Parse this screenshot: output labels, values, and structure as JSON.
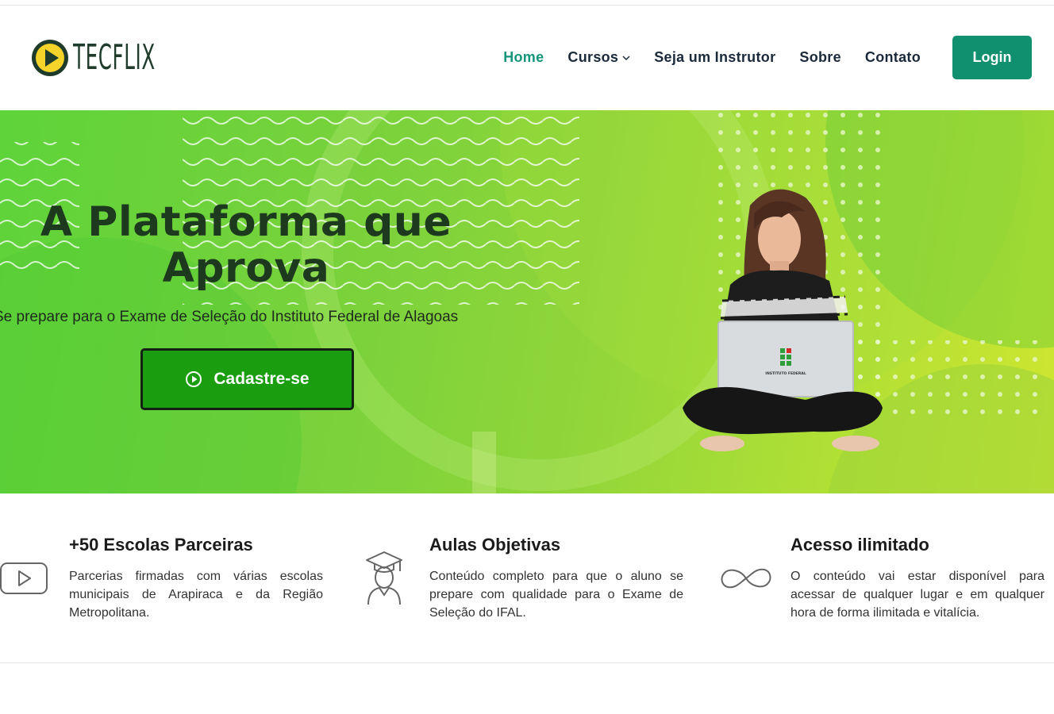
{
  "brand": {
    "name": "TECFLIX",
    "accent": "#11906f",
    "logo_yellow": "#f4d32a",
    "logo_dark": "#1f3b2b"
  },
  "nav": {
    "items": [
      {
        "label": "Home",
        "active": true
      },
      {
        "label": "Cursos",
        "dropdown": true
      },
      {
        "label": "Seja um Instrutor"
      },
      {
        "label": "Sobre"
      },
      {
        "label": "Contato"
      }
    ],
    "login_label": "Login"
  },
  "hero": {
    "title_line1": "A Plataforma que",
    "title_line2": "Aprova",
    "subtitle": "Se prepare para o Exame de Seleção do Instituto Federal de Alagoas",
    "cta_label": "Cadastre-se",
    "laptop_logo_text": "INSTITUTO FEDERAL"
  },
  "features": [
    {
      "icon": "play-icon",
      "title": "+50 Escolas Parceiras",
      "text": "Parcerias firmadas com várias escolas municipais de Arapiraca e da Região Metropolitana."
    },
    {
      "icon": "graduate-icon",
      "title": "Aulas Objetivas",
      "text": "Conteúdo completo para que o aluno se prepare com qualidade para o Exame de Seleção do IFAL."
    },
    {
      "icon": "infinity-icon",
      "title": "Acesso ilimitado",
      "text": "O conteúdo vai estar disponível para acessar de qualquer lugar e em qualquer hora de forma ilimitada e vitalícia."
    }
  ]
}
